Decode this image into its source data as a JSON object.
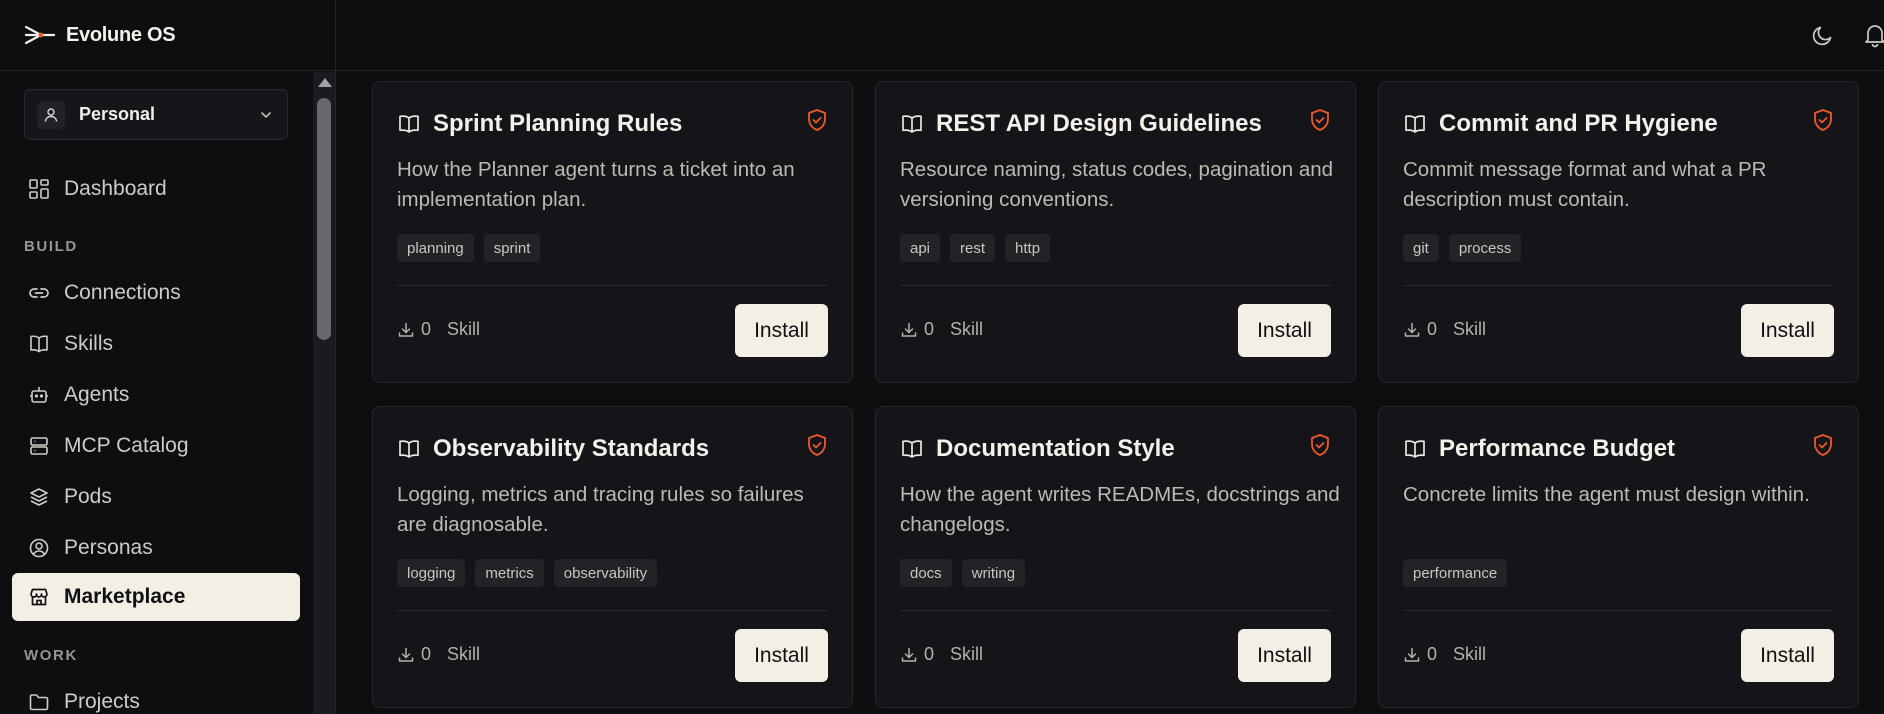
{
  "app": {
    "name": "Evolune OS"
  },
  "workspace": {
    "label": "Personal"
  },
  "nav": {
    "dashboard": "Dashboard",
    "build_section": "BUILD",
    "connections": "Connections",
    "skills": "Skills",
    "agents": "Agents",
    "mcp_catalog": "MCP Catalog",
    "pods": "Pods",
    "personas": "Personas",
    "marketplace": "Marketplace",
    "work_section": "WORK",
    "projects": "Projects",
    "active_item": "Marketplace"
  },
  "topbar": {
    "icons": [
      "moon-icon",
      "bell-icon"
    ]
  },
  "colors": {
    "accent": "#ea5a2c",
    "active_bg": "#f3efe4",
    "background": "#0e0d10",
    "card_bg": "#151418"
  },
  "cards": [
    {
      "title": "Sprint Planning Rules",
      "description": "How the Planner agent turns a ticket into an implementation plan.",
      "tags": [
        "planning",
        "sprint"
      ],
      "downloads": "0",
      "type": "Skill",
      "action": "Install"
    },
    {
      "title": "REST API Design Guidelines",
      "description": "Resource naming, status codes, pagination and versioning conventions.",
      "tags": [
        "api",
        "rest",
        "http"
      ],
      "downloads": "0",
      "type": "Skill",
      "action": "Install"
    },
    {
      "title": "Commit and PR Hygiene",
      "description": "Commit message format and what a PR description must contain.",
      "tags": [
        "git",
        "process"
      ],
      "downloads": "0",
      "type": "Skill",
      "action": "Install"
    },
    {
      "title": "Observability Standards",
      "description": "Logging, metrics and tracing rules so failures are diagnosable.",
      "tags": [
        "logging",
        "metrics",
        "observability"
      ],
      "downloads": "0",
      "type": "Skill",
      "action": "Install"
    },
    {
      "title": "Documentation Style",
      "description": "How the agent writes READMEs, docstrings and changelogs.",
      "tags": [
        "docs",
        "writing"
      ],
      "downloads": "0",
      "type": "Skill",
      "action": "Install"
    },
    {
      "title": "Performance Budget",
      "description": "Concrete limits the agent must design within.",
      "tags": [
        "performance"
      ],
      "downloads": "0",
      "type": "Skill",
      "action": "Install"
    }
  ]
}
